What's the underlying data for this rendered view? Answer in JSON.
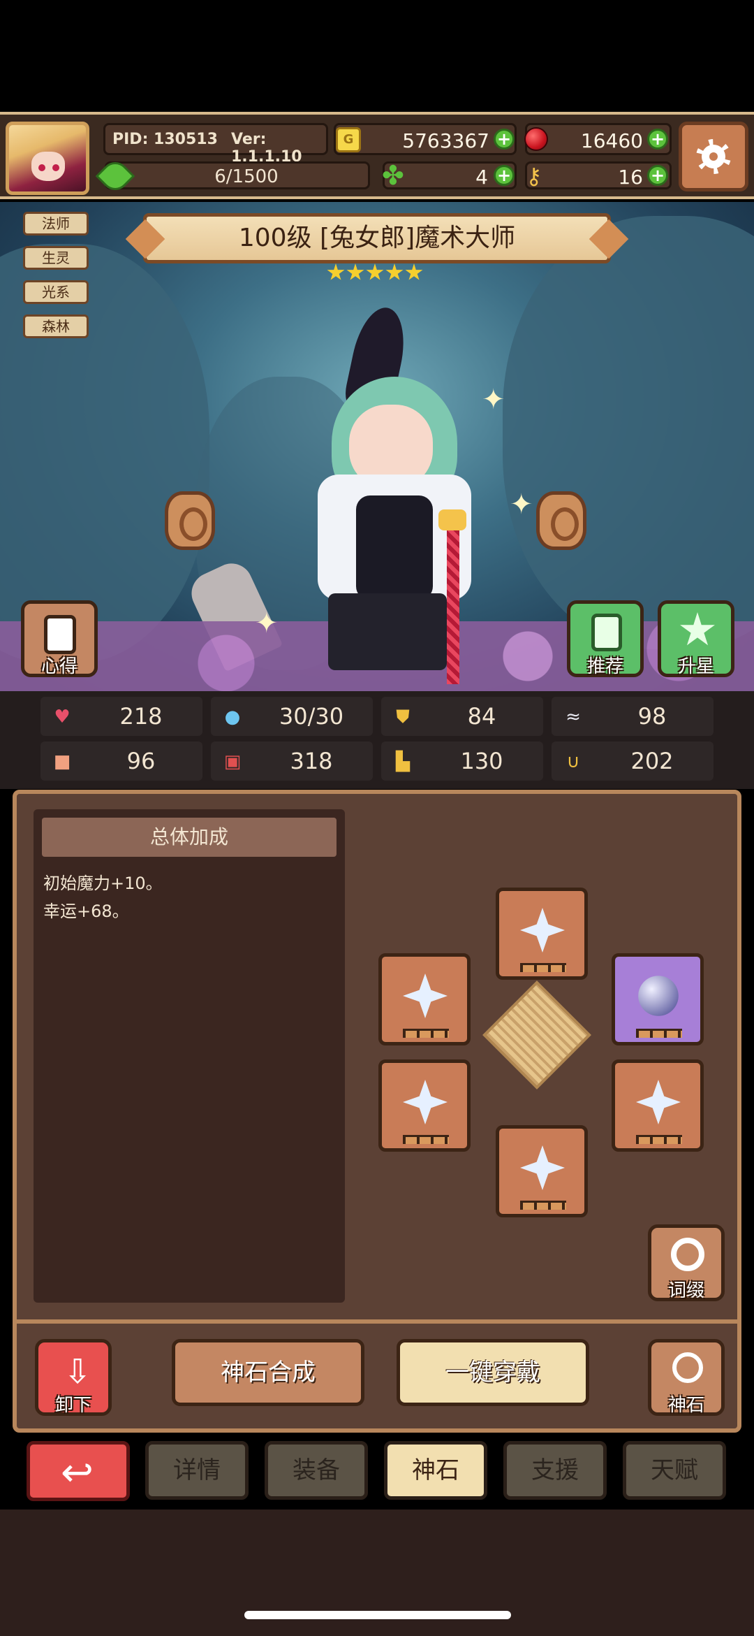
{
  "header": {
    "pid": "PID: 130513",
    "version": "Ver: 1.1.1.10",
    "coin_icon": "coin-icon",
    "coins": "5763367",
    "gems": "16460",
    "stamina": "6/1500",
    "clover": "4",
    "keys": "16"
  },
  "hero": {
    "tags": [
      "法师",
      "生灵",
      "光系",
      "森林"
    ],
    "title": "100级  [兔女郎]魔术大师",
    "stars": 5
  },
  "scene_buttons": {
    "notes": "心得",
    "recommend": "推荐",
    "star_up": "升星"
  },
  "stats": [
    {
      "icon": "heart-icon",
      "value": "218",
      "color": "#e8506a"
    },
    {
      "icon": "water-drop-icon",
      "value": "30/30",
      "color": "#6ec6f0"
    },
    {
      "icon": "shield-icon",
      "value": "84",
      "color": "#f0c040"
    },
    {
      "icon": "wing-icon",
      "value": "98",
      "color": "#e8e8f0"
    },
    {
      "icon": "fist-icon",
      "value": "96",
      "color": "#f0a080"
    },
    {
      "icon": "book-icon",
      "value": "318",
      "color": "#e05050"
    },
    {
      "icon": "boots-icon",
      "value": "130",
      "color": "#f0c040"
    },
    {
      "icon": "horseshoe-icon",
      "value": "202",
      "color": "#f0c040"
    }
  ],
  "bonus": {
    "title": "总体加成",
    "lines": [
      "初始魔力+10。",
      "幸运+68。"
    ]
  },
  "panel_buttons": {
    "affix": "词缀",
    "unequip": "卸下",
    "synthesize": "神石合成",
    "equip_all": "一键穿戴",
    "godstone": "神石"
  },
  "tabs": [
    "详情",
    "装备",
    "神石",
    "支援",
    "天赋"
  ],
  "active_tab": "神石"
}
